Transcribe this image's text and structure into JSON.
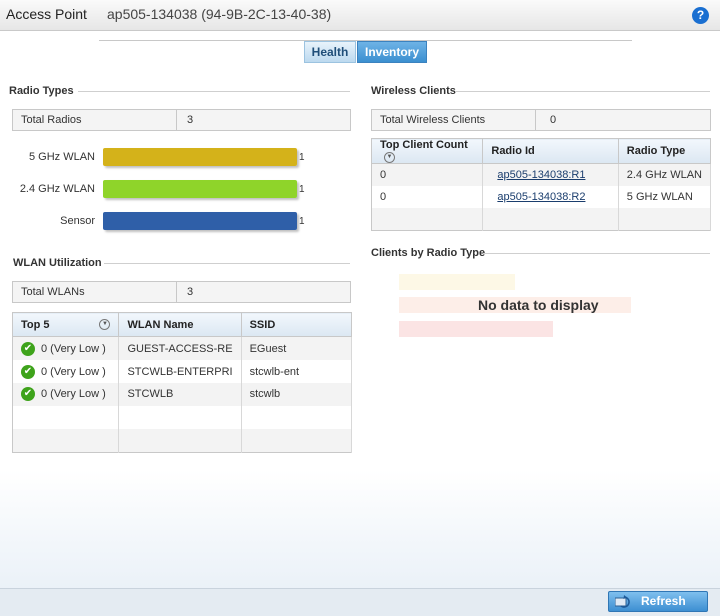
{
  "header": {
    "title": "Access Point",
    "subtitle": "ap505-134038 (94-9B-2C-13-40-38)",
    "help_icon": "?"
  },
  "tabs": [
    {
      "label": "Health",
      "selected": false
    },
    {
      "label": "Inventory",
      "selected": true
    }
  ],
  "radio_types": {
    "section_title": "Radio Types",
    "total_label": "Total Radios",
    "total_value": "3",
    "bars": [
      {
        "label": "5 GHz WLAN",
        "count": "1",
        "color": "#d4b21a"
      },
      {
        "label": "2.4 GHz WLAN",
        "count": "1",
        "color": "#8fd42a"
      },
      {
        "label": "Sensor",
        "count": "1",
        "color": "#2f5fa8"
      }
    ]
  },
  "wlan_utilization": {
    "section_title": "WLAN Utilization",
    "total_label": "Total WLANs",
    "total_value": "3",
    "columns": [
      "Top 5",
      "WLAN Name",
      "SSID"
    ],
    "rows": [
      {
        "top": "0 (Very Low )",
        "name": "GUEST-ACCESS-RE",
        "ssid": "EGuest"
      },
      {
        "top": "0 (Very Low )",
        "name": "STCWLB-ENTERPRI",
        "ssid": "stcwlb-ent"
      },
      {
        "top": "0 (Very Low )",
        "name": "STCWLB",
        "ssid": "stcwlb"
      }
    ]
  },
  "wireless_clients": {
    "section_title": "Wireless Clients",
    "total_label": "Total Wireless Clients",
    "total_value": "0",
    "columns": [
      "Top Client Count",
      "Radio Id",
      "Radio Type"
    ],
    "rows": [
      {
        "count": "0",
        "radio_id": "ap505-134038:R1",
        "radio_type": "2.4 GHz WLAN"
      },
      {
        "count": "0",
        "radio_id": "ap505-134038:R2",
        "radio_type": "5 GHz WLAN"
      }
    ]
  },
  "clients_by_radio": {
    "section_title": "Clients by Radio Type",
    "empty_message": "No data to display"
  },
  "footer": {
    "refresh_label": "Refresh"
  }
}
